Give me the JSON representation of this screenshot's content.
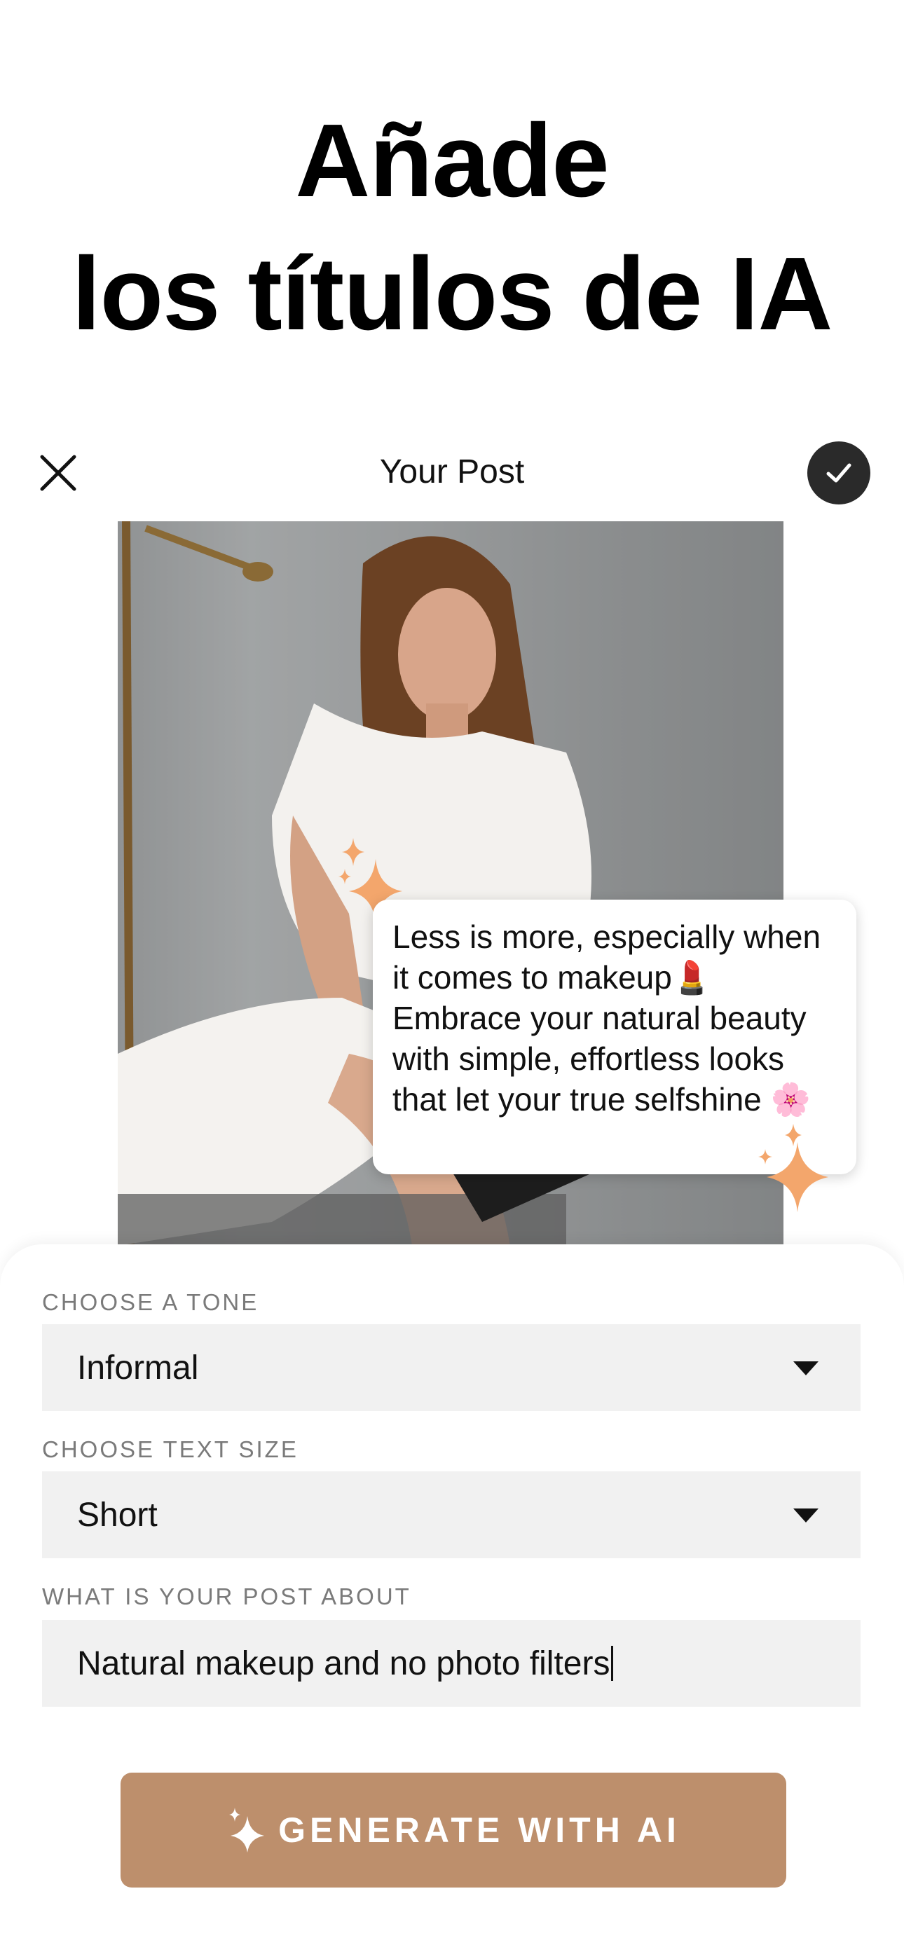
{
  "headline": {
    "line1": "Añade",
    "line2": "los títulos de IA"
  },
  "topbar": {
    "title": "Your Post",
    "close_icon": "close-icon",
    "confirm_icon": "checkmark-icon"
  },
  "caption": {
    "text": "Less is more, especially when it comes to makeup💄 Embrace your natural beauty with simple, effortless looks that let your true selfshine 🌸"
  },
  "tone": {
    "label": "CHOOSE A TONE",
    "value": "Informal"
  },
  "text_size": {
    "label": "CHOOSE TEXT SIZE",
    "value": "Short"
  },
  "about": {
    "label": "WHAT IS YOUR POST ABOUT",
    "value": "Natural makeup and no photo filters"
  },
  "generate": {
    "label": "GENERATE WITH AI",
    "icon": "sparkle-icon"
  },
  "colors": {
    "accent": "#bd8f6c",
    "sparkle": "#f3a66c",
    "confirm_bg": "#2a2a2a",
    "field_bg": "#f1f1f1"
  }
}
